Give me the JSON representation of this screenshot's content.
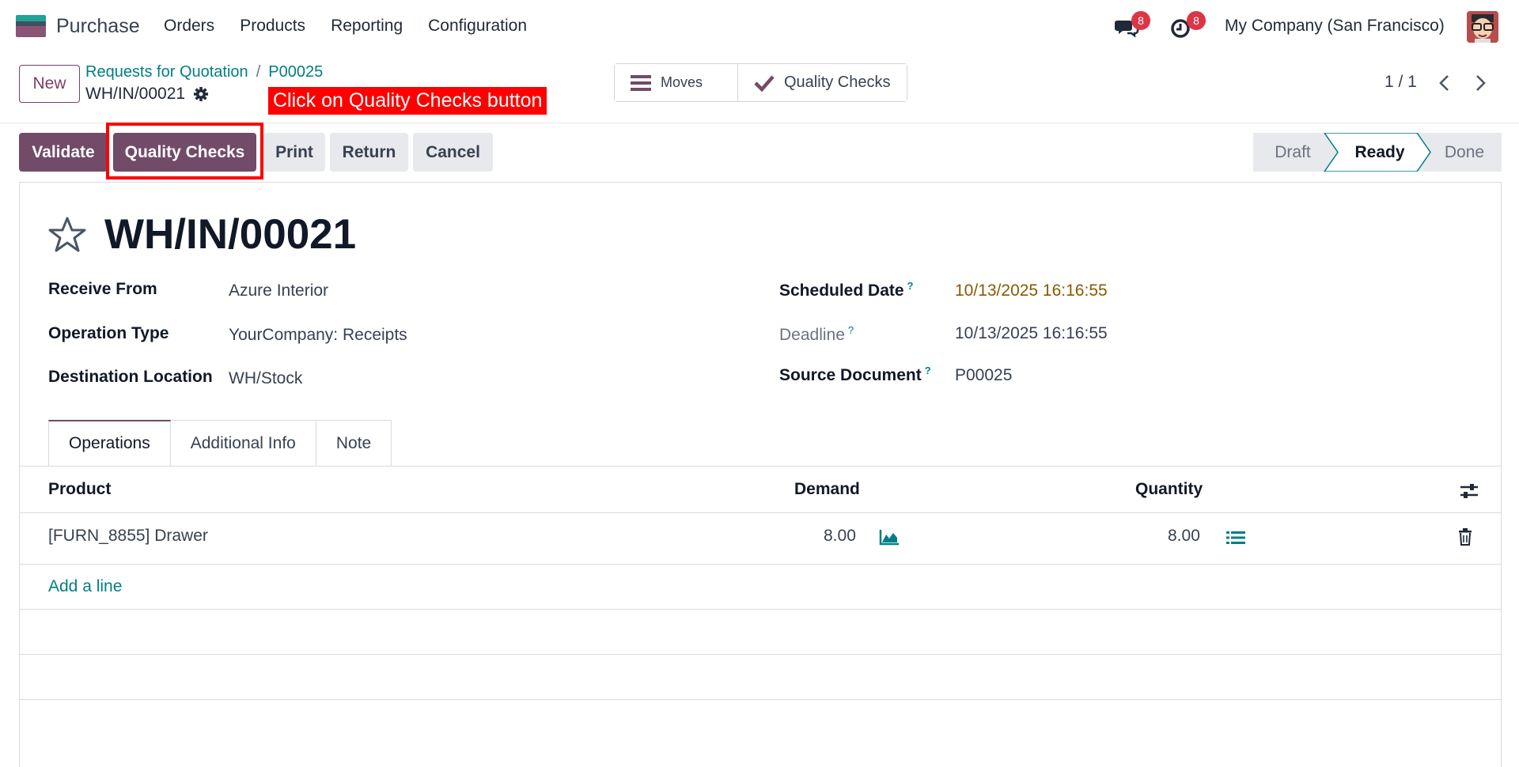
{
  "navbar": {
    "app_name": "Purchase",
    "menu": [
      "Orders",
      "Products",
      "Reporting",
      "Configuration"
    ],
    "messages_badge": "8",
    "activities_badge": "8",
    "company": "My Company (San Francisco)"
  },
  "control_panel": {
    "new_label": "New",
    "breadcrumb": [
      "Requests for Quotation",
      "P00025"
    ],
    "current_record": "WH/IN/00021",
    "annotation": "Click on Quality Checks button",
    "smart_buttons": {
      "moves": "Moves",
      "quality_checks": "Quality Checks"
    },
    "pager": "1 / 1"
  },
  "actions": {
    "validate": "Validate",
    "quality_checks": "Quality Checks",
    "print": "Print",
    "return": "Return",
    "cancel": "Cancel"
  },
  "statusbar": [
    "Draft",
    "Ready",
    "Done"
  ],
  "active_status": "Ready",
  "record": {
    "title": "WH/IN/00021",
    "fields_left": [
      {
        "label": "Receive From",
        "value": "Azure Interior"
      },
      {
        "label": "Operation Type",
        "value": "YourCompany: Receipts"
      },
      {
        "label": "Destination Location",
        "value": "WH/Stock"
      }
    ],
    "fields_right": [
      {
        "label": "Scheduled Date",
        "help": "?",
        "value": "10/13/2025 16:16:55"
      },
      {
        "label": "Deadline",
        "help": "?",
        "value": "10/13/2025 16:16:55"
      },
      {
        "label": "Source Document",
        "help": "?",
        "value": "P00025"
      }
    ]
  },
  "tabs": [
    "Operations",
    "Additional Info",
    "Note"
  ],
  "table": {
    "headers": {
      "product": "Product",
      "demand": "Demand",
      "quantity": "Quantity"
    },
    "rows": [
      {
        "product": "[FURN_8855] Drawer",
        "demand": "8.00",
        "quantity": "8.00"
      }
    ],
    "add_line": "Add a line"
  },
  "colors": {
    "brand": "#714b67",
    "link": "#017e84",
    "annotation": "#ff0000",
    "badge": "#dc3545"
  }
}
